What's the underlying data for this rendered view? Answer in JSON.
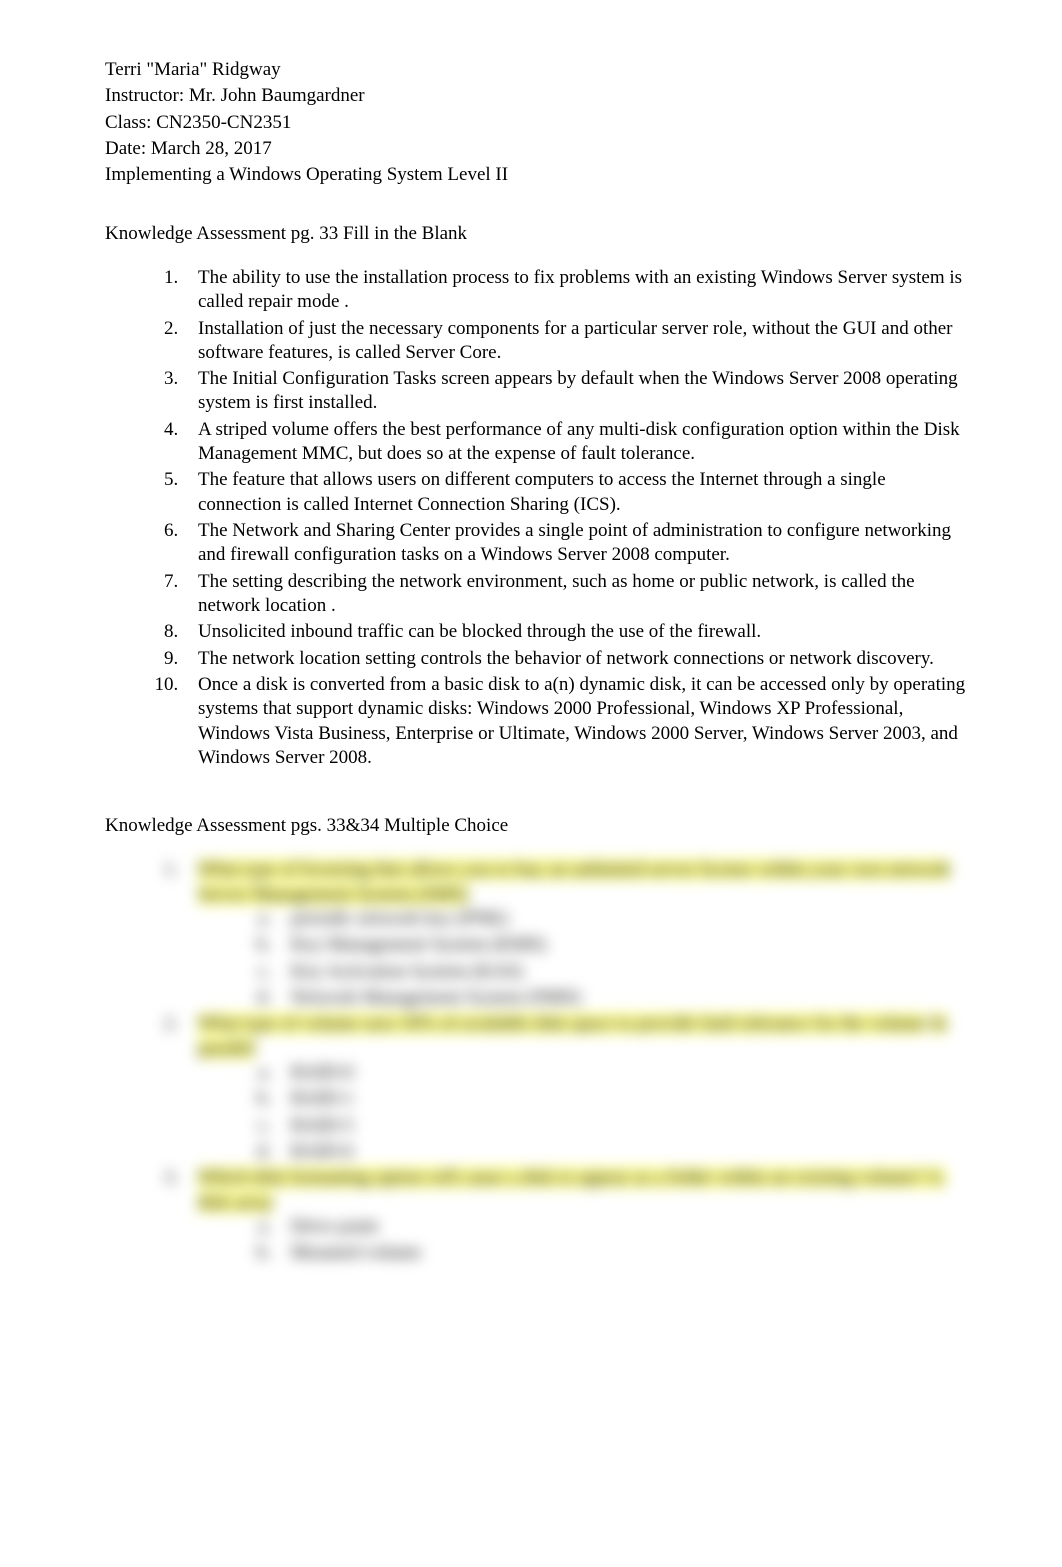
{
  "header": {
    "name": "Terri \"Maria\" Ridgway",
    "instructor": "Instructor: Mr. John Baumgardner",
    "class": "Class: CN2350-CN2351",
    "date": "Date: March 28, 2017",
    "title": "Implementing a Windows Operating System Level II"
  },
  "section1": {
    "heading": "Knowledge Assessment pg. 33 Fill in the Blank",
    "items": [
      {
        "pre": "The ability to use the installation process to fix problems with an existing Windows Server system is called ",
        "ans": "repair mode",
        "post": " ."
      },
      {
        "pre": "Installation of just the necessary components for a particular server role, without the GUI and other software features, is called   ",
        "ans": "Server Core",
        "post": "."
      },
      {
        "pre": "The ",
        "ans": "Initial Configuration Tasks",
        "post": " screen appears by default when the Windows Server 2008 operating system is first installed."
      },
      {
        "pre": "A ",
        "ans": "striped volume",
        "post": "  offers the best performance of any multi-disk configuration option within the Disk Management MMC, but does so at the expense of fault tolerance."
      },
      {
        "pre": "The feature that allows users on different computers to access the Internet through a single connection is called ",
        "ans": "Internet Connection Sharing (ICS)",
        "post": "."
      },
      {
        "pre": "The ",
        "ans": "Network and Sharing Center",
        "post": "   provides a single point of administration to configure networking and firewall configuration tasks on a Windows Server 2008 computer."
      },
      {
        "pre": "The setting describing the network environment, such as home or public network, is called the ",
        "ans": "network location",
        "post": " ."
      },
      {
        "pre": "Unsolicited inbound traffic can be blocked through the use of the   ",
        "ans": "firewall",
        "post": "."
      },
      {
        "pre": "The network location setting controls the behavior of   ",
        "ans": "network connections or network discovery",
        "post": "."
      },
      {
        "pre": "Once a disk is converted from a basic disk to a(n) ",
        "ans": "dynamic disk",
        "post": ", it can be accessed only by operating systems that support dynamic disks: Windows 2000 Professional, Windows XP Professional, Windows Vista Business, Enterprise or Ultimate, Windows 2000 Server, Windows Server 2003, and Windows Server 2008."
      }
    ]
  },
  "section2": {
    "heading": "Knowledge Assessment pgs. 33&34 Multiple Choice",
    "questions": [
      {
        "q_pre": "What type of licensing that allows you to buy an unlimited server license within your own network",
        "q_ans": "Server Management System (SMS)",
        "options": [
          "periodic network key (PNK)",
          "Key Management System (KMS)",
          "Key Activation System (KAS)",
          "Network Management System (NMS)"
        ]
      },
      {
        "q_pre": "What type of volume uses 50% of available disk space to provide fault tolerance for the volume",
        "q_ans": "In parallel",
        "options": [
          "RAID-0",
          "RAID-1",
          "RAID-5",
          "RAID-6"
        ]
      },
      {
        "q_pre": "Which disk formatting option will cause a disk to appear as a folder within an existing volume? A.",
        "q_ans": "disk array",
        "options": [
          "Drive point",
          "Mounted volume"
        ]
      }
    ]
  }
}
